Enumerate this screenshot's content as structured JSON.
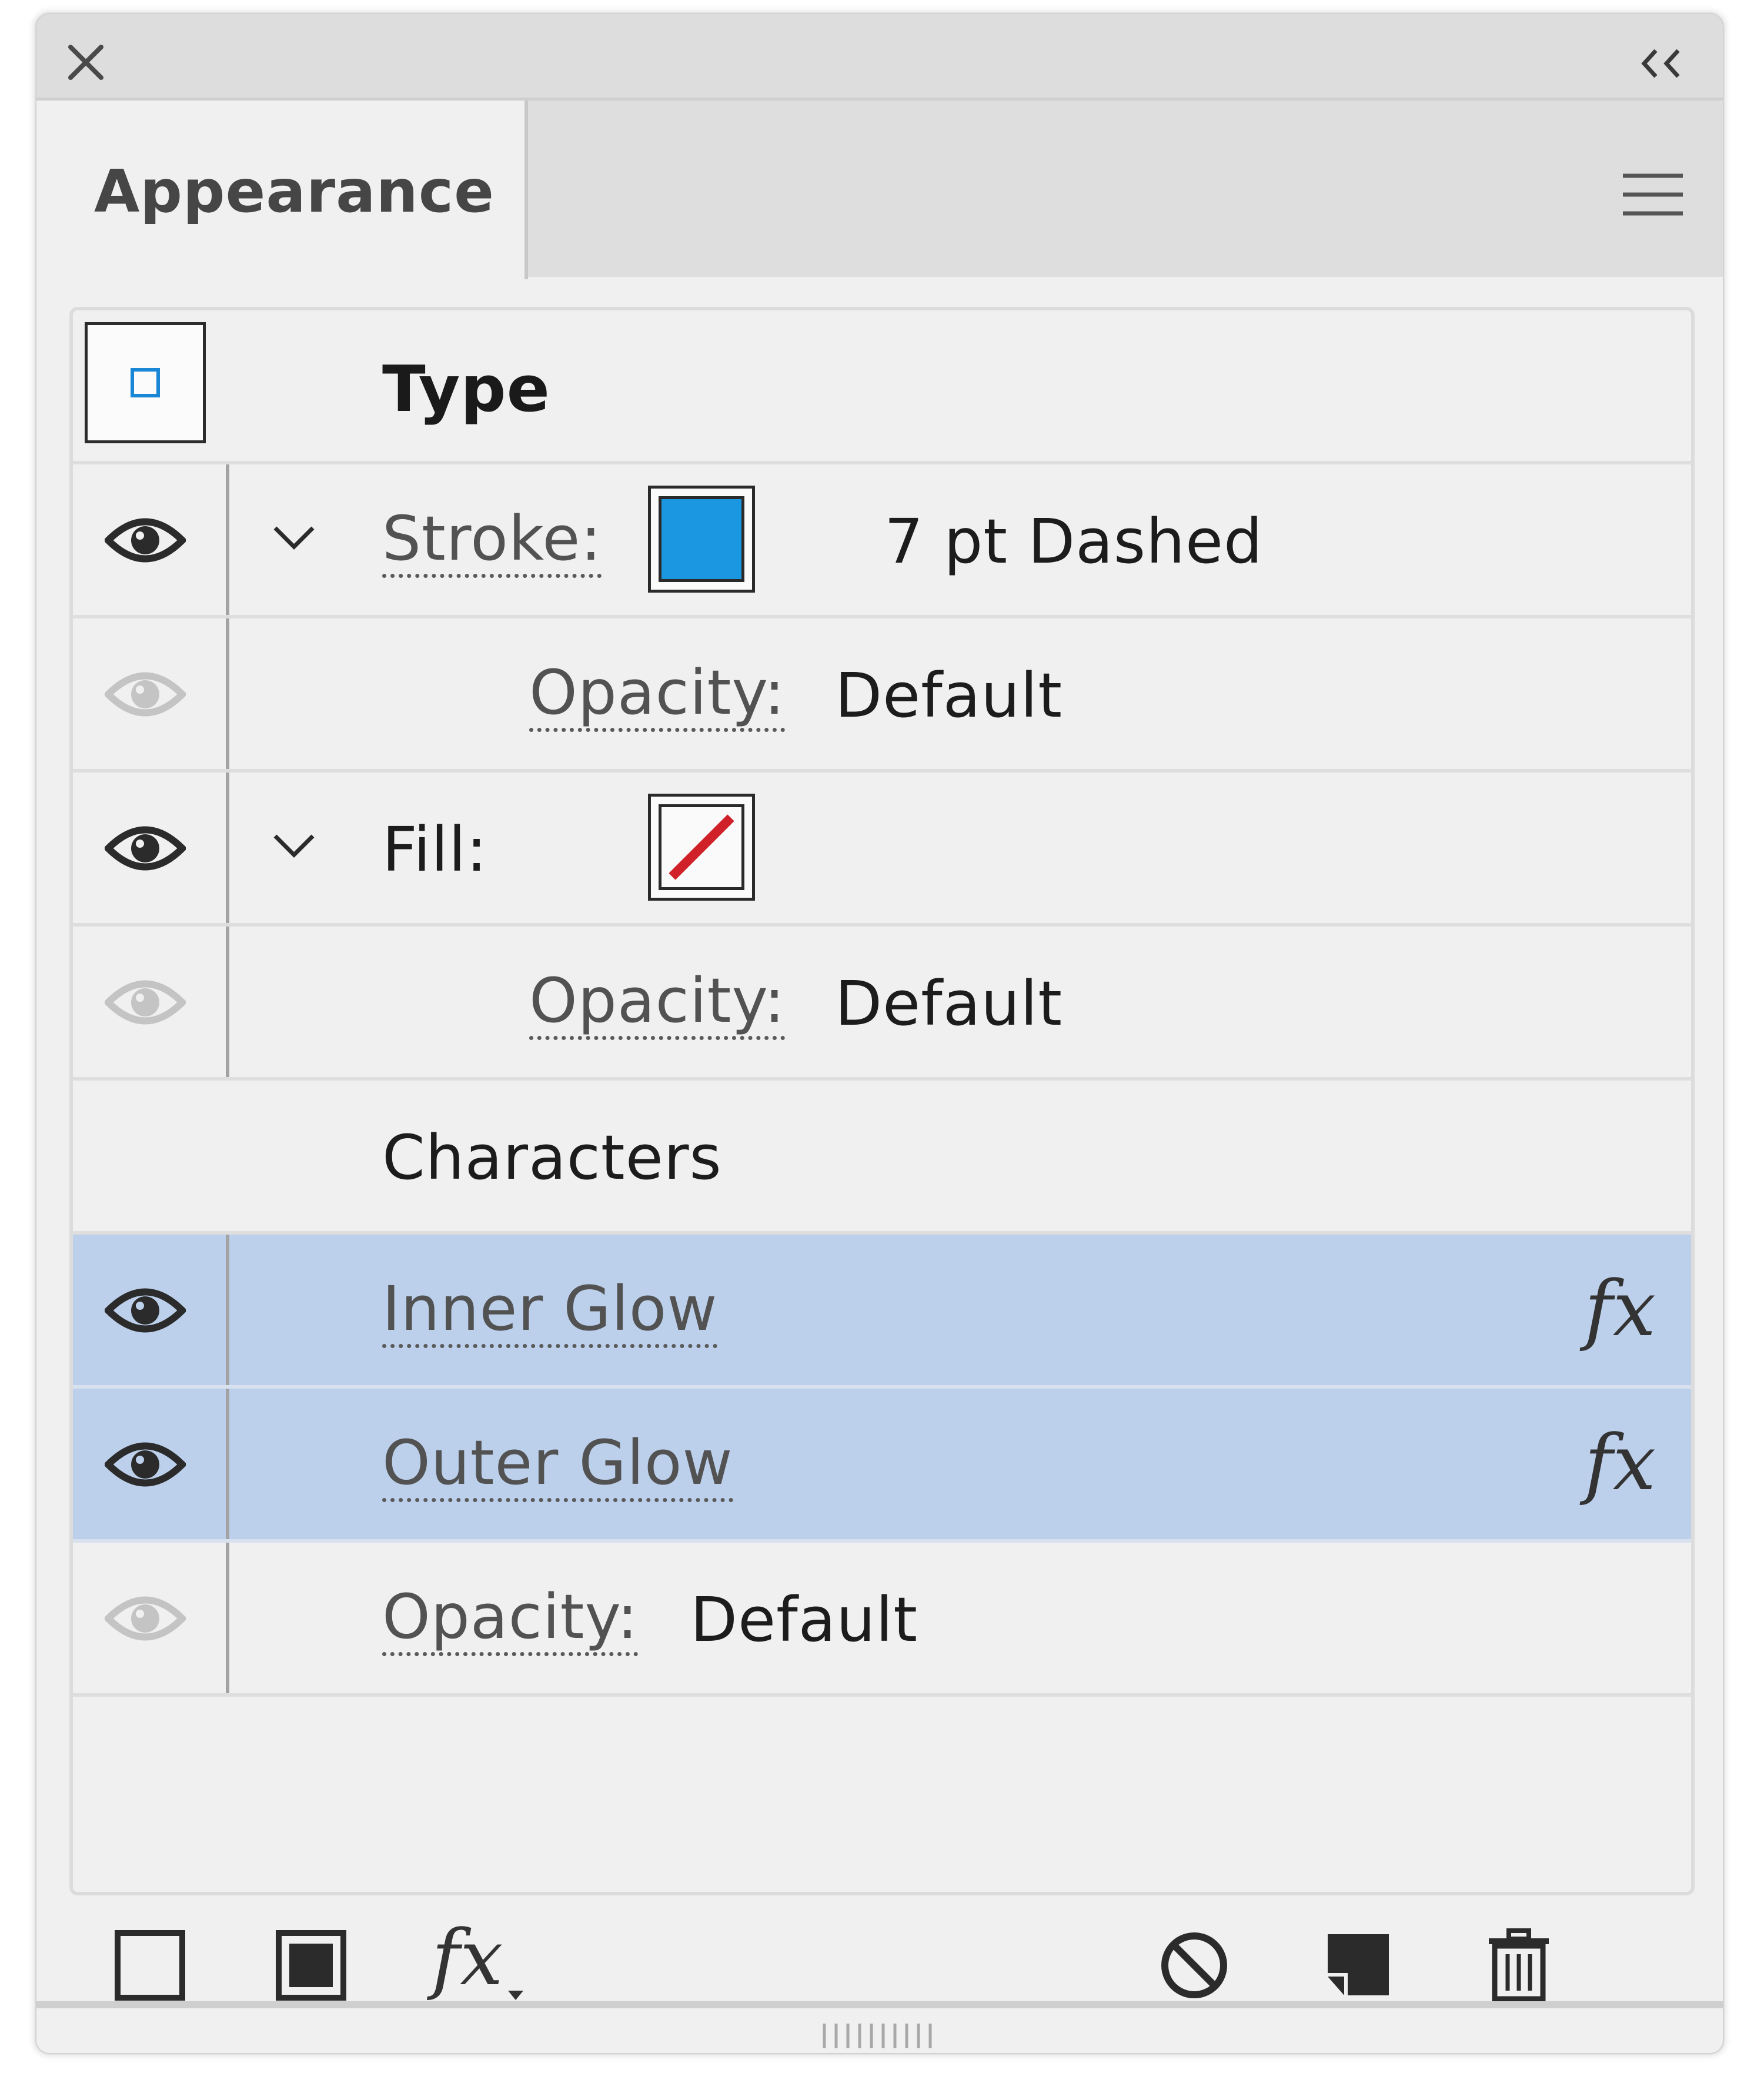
{
  "panel": {
    "tab_label": "Appearance"
  },
  "target": {
    "label": "Type"
  },
  "rows": {
    "stroke": {
      "label": "Stroke:",
      "value": "7 pt Dashed",
      "swatch_color": "#1b96e0"
    },
    "stroke_opacity": {
      "label": "Opacity:",
      "value": "Default"
    },
    "fill": {
      "label": "Fill:",
      "swatch": "none"
    },
    "fill_opacity": {
      "label": "Opacity:",
      "value": "Default"
    },
    "characters": {
      "label": "Characters"
    },
    "inner_glow": {
      "label": "Inner Glow",
      "fx": "fx"
    },
    "outer_glow": {
      "label": "Outer Glow",
      "fx": "fx"
    },
    "opacity": {
      "label": "Opacity:",
      "value": "Default"
    }
  },
  "footer": {
    "fx_label": "fx"
  },
  "colors": {
    "selection": "#bcd0eb",
    "stroke_swatch": "#1b96e0",
    "none_slash": "#d0202a",
    "target_icon": "#1a86d6"
  },
  "icons": {
    "close": "close-icon",
    "collapse": "double-chevron-left-icon",
    "menu": "hamburger-menu-icon",
    "eye": "eye-icon",
    "chevron": "chevron-down-icon",
    "add_stroke": "add-new-stroke-icon",
    "add_fill": "add-new-fill-icon",
    "add_effect": "add-new-effect-icon",
    "clear": "clear-appearance-icon",
    "duplicate": "duplicate-item-icon",
    "delete": "trash-icon"
  }
}
